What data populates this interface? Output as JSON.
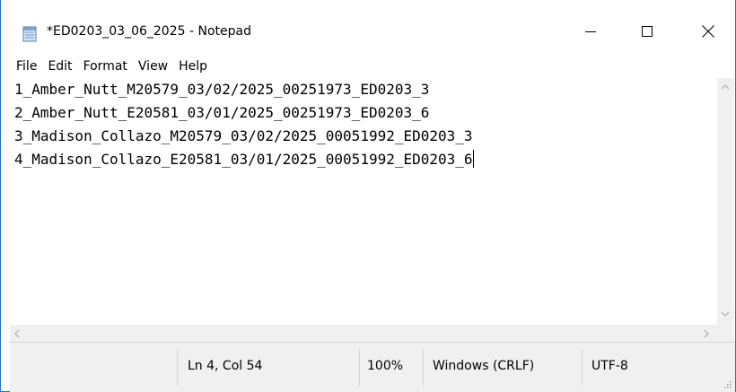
{
  "window": {
    "title": "*ED0203_03_06_2025 - Notepad",
    "icon": "notepad-icon",
    "controls": {
      "minimize": "minimize-icon",
      "maximize": "maximize-icon",
      "close": "close-icon"
    }
  },
  "menu": [
    "File",
    "Edit",
    "Format",
    "View",
    "Help"
  ],
  "editor": {
    "lines": [
      "1_Amber_Nutt_M20579_03/02/2025_00251973_ED0203_3",
      "2_Amber_Nutt_E20581_03/01/2025_00251973_ED0203_6",
      "3_Madison_Collazo_M20579_03/02/2025_00051992_ED0203_3",
      "4_Madison_Collazo_E20581_03/01/2025_00051992_ED0203_6"
    ]
  },
  "status": {
    "position": "Ln 4, Col 54",
    "zoom": "100%",
    "line_ending": "Windows (CRLF)",
    "encoding": "UTF-8"
  },
  "colors": {
    "title_accent": "#1a66d1",
    "chrome_bg": "#f0f0f0"
  }
}
